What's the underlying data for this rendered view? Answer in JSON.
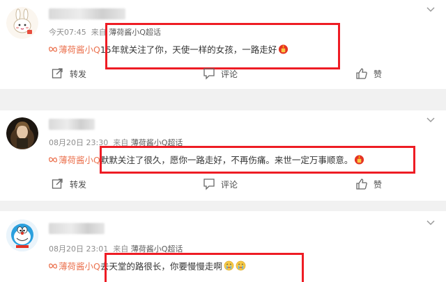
{
  "comments": [
    {
      "time": "今天07:45",
      "source_prefix": "来自",
      "source_topic": "薄荷酱小Q超话",
      "tag": "薄荷酱小Q",
      "text": "15年就关注了你，天使一样的女孩，一路走好",
      "emojis": [
        "candle-icon"
      ],
      "actions": {
        "repost": "转发",
        "comment": "评论",
        "like": "赞"
      }
    },
    {
      "time": "08月20日 23:30",
      "source_prefix": "来自",
      "source_topic": "薄荷酱小Q超话",
      "tag": "薄荷酱小Q",
      "text": "默默关注了很久，愿你一路走好，不再伤痛。来世一定万事顺意。",
      "emojis": [
        "candle-icon"
      ],
      "actions": {
        "repost": "转发",
        "comment": "评论",
        "like": "赞"
      }
    },
    {
      "time": "08月20日 23:01",
      "source_prefix": "来自",
      "source_topic": "薄荷酱小Q超话",
      "tag": "薄荷酱小Q",
      "text": "去天堂的路很长，你要慢慢走啊",
      "emojis": [
        "sad-face-icon",
        "sad-face-icon"
      ],
      "actions": null
    }
  ],
  "colors": {
    "highlight_box": "#ee1c24",
    "tag_orange": "#eb7350",
    "meta_gray": "#8d8d8d"
  }
}
